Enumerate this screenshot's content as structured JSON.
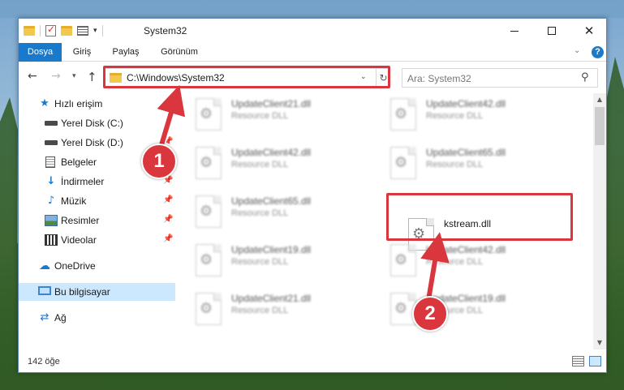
{
  "window": {
    "title": "System32",
    "controls": {
      "minimize": "minimize",
      "maximize": "maximize",
      "close": "✕"
    }
  },
  "ribbon": {
    "tabs": [
      "Dosya",
      "Giriş",
      "Paylaş",
      "Görünüm"
    ],
    "help": "?"
  },
  "address": {
    "path": "C:\\Windows\\System32",
    "search_placeholder": "Ara: System32"
  },
  "sidebar": {
    "items": [
      {
        "label": "Hızlı erişim",
        "icon": "star-icon",
        "pinned": false
      },
      {
        "label": "Yerel Disk (C:)",
        "icon": "drive-icon",
        "pinned": false
      },
      {
        "label": "Yerel Disk (D:)",
        "icon": "drive-icon",
        "pinned": true
      },
      {
        "label": "Belgeler",
        "icon": "documents-icon",
        "pinned": true
      },
      {
        "label": "İndirmeler",
        "icon": "download-icon",
        "pinned": true
      },
      {
        "label": "Müzik",
        "icon": "music-icon",
        "pinned": true
      },
      {
        "label": "Resimler",
        "icon": "pictures-icon",
        "pinned": true
      },
      {
        "label": "Videolar",
        "icon": "videos-icon",
        "pinned": true
      },
      {
        "label": "OneDrive",
        "icon": "cloud-icon",
        "pinned": false
      },
      {
        "label": "Bu bilgisayar",
        "icon": "computer-icon",
        "pinned": false,
        "selected": true
      },
      {
        "label": "Ağ",
        "icon": "network-icon",
        "pinned": false
      }
    ]
  },
  "files": [
    {
      "name": "UpdateClient21.dll",
      "type": "Resource DLL",
      "blurred": true
    },
    {
      "name": "UpdateClient42.dll",
      "type": "Resource DLL",
      "blurred": true
    },
    {
      "name": "UpdateClient42.dll",
      "type": "Resource DLL",
      "blurred": true
    },
    {
      "name": "UpdateClient65.dll",
      "type": "Resource DLL",
      "blurred": true
    },
    {
      "name": "UpdateClient65.dll",
      "type": "Resource DLL",
      "blurred": true
    },
    {
      "name": "kstream.dll",
      "type": "",
      "blurred": false
    },
    {
      "name": "UpdateClient19.dll",
      "type": "Resource DLL",
      "blurred": true
    },
    {
      "name": "UpdateClient42.dll",
      "type": "Resource DLL",
      "blurred": true
    },
    {
      "name": "UpdateClient21.dll",
      "type": "Resource DLL",
      "blurred": true
    },
    {
      "name": "UpdateClient19.dll",
      "type": "Resource DLL",
      "blurred": true
    }
  ],
  "status": {
    "item_count": "142 öğe"
  },
  "annotations": {
    "step1": "1",
    "step2": "2",
    "color": "#d9363e"
  }
}
